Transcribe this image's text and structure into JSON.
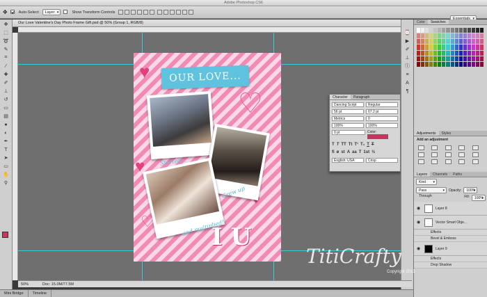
{
  "app": {
    "window_title": "Adobe Photoshop CS6",
    "workspace": "Essentials"
  },
  "options_bar": {
    "auto_select_label": "Auto-Select:",
    "auto_select_value": "Layer",
    "show_transform_label": "Show Transform Controls"
  },
  "document": {
    "tab_title": "Our Love Valentine's Day Photo Frame Gift.psd @ 50% (Group 1, RGB/8)",
    "zoom": "50%",
    "doc_size": "Doc: 15.0M/77.5M"
  },
  "artwork": {
    "banner_text": "OUR LOVE...",
    "captions": [
      "Started...",
      "Grew up",
      "...and multiplied!"
    ],
    "monogram": "I U",
    "colors": {
      "pink_stripe": "#f08bb4",
      "light_stripe": "#fbd7e7",
      "banner": "#5fc2de",
      "heart": "#d8336c"
    }
  },
  "character_panel": {
    "tabs": [
      "Character",
      "Paragraph"
    ],
    "font_family": "Dancing Script",
    "font_style": "Regular",
    "size": "56 pt",
    "leading": "67.2 pt",
    "kerning": "Metrics",
    "tracking": "0",
    "baseline": "0 pt",
    "v_scale": "100%",
    "h_scale": "100%",
    "color_label": "Color:",
    "language": "English: USA",
    "antialias": "Crisp"
  },
  "swatches_panel": {
    "tabs": [
      "Color",
      "Swatches"
    ]
  },
  "adjustments_panel": {
    "tabs": [
      "Adjustments",
      "Styles"
    ],
    "heading": "Add an adjustment"
  },
  "layers_panel": {
    "tabs": [
      "Layers",
      "Channels",
      "Paths"
    ],
    "filter_kind": "Kind",
    "blend_mode": "Pass Through",
    "opacity_label": "Opacity:",
    "opacity": "100%",
    "fill_label": "Fill:",
    "fill": "100%",
    "layers": [
      {
        "name": "Layer 8"
      },
      {
        "name": "Vector Smart Obje..."
      },
      {
        "name": "Layer 9"
      }
    ],
    "effects": [
      "Effects",
      "Bevel & Emboss",
      "Effects",
      "Drop Shadow"
    ]
  },
  "bottom_tabs": [
    "Mini Bridge",
    "Timeline"
  ],
  "watermark": {
    "text": "TitiCrafty",
    "sub": "Copyright 2013"
  }
}
